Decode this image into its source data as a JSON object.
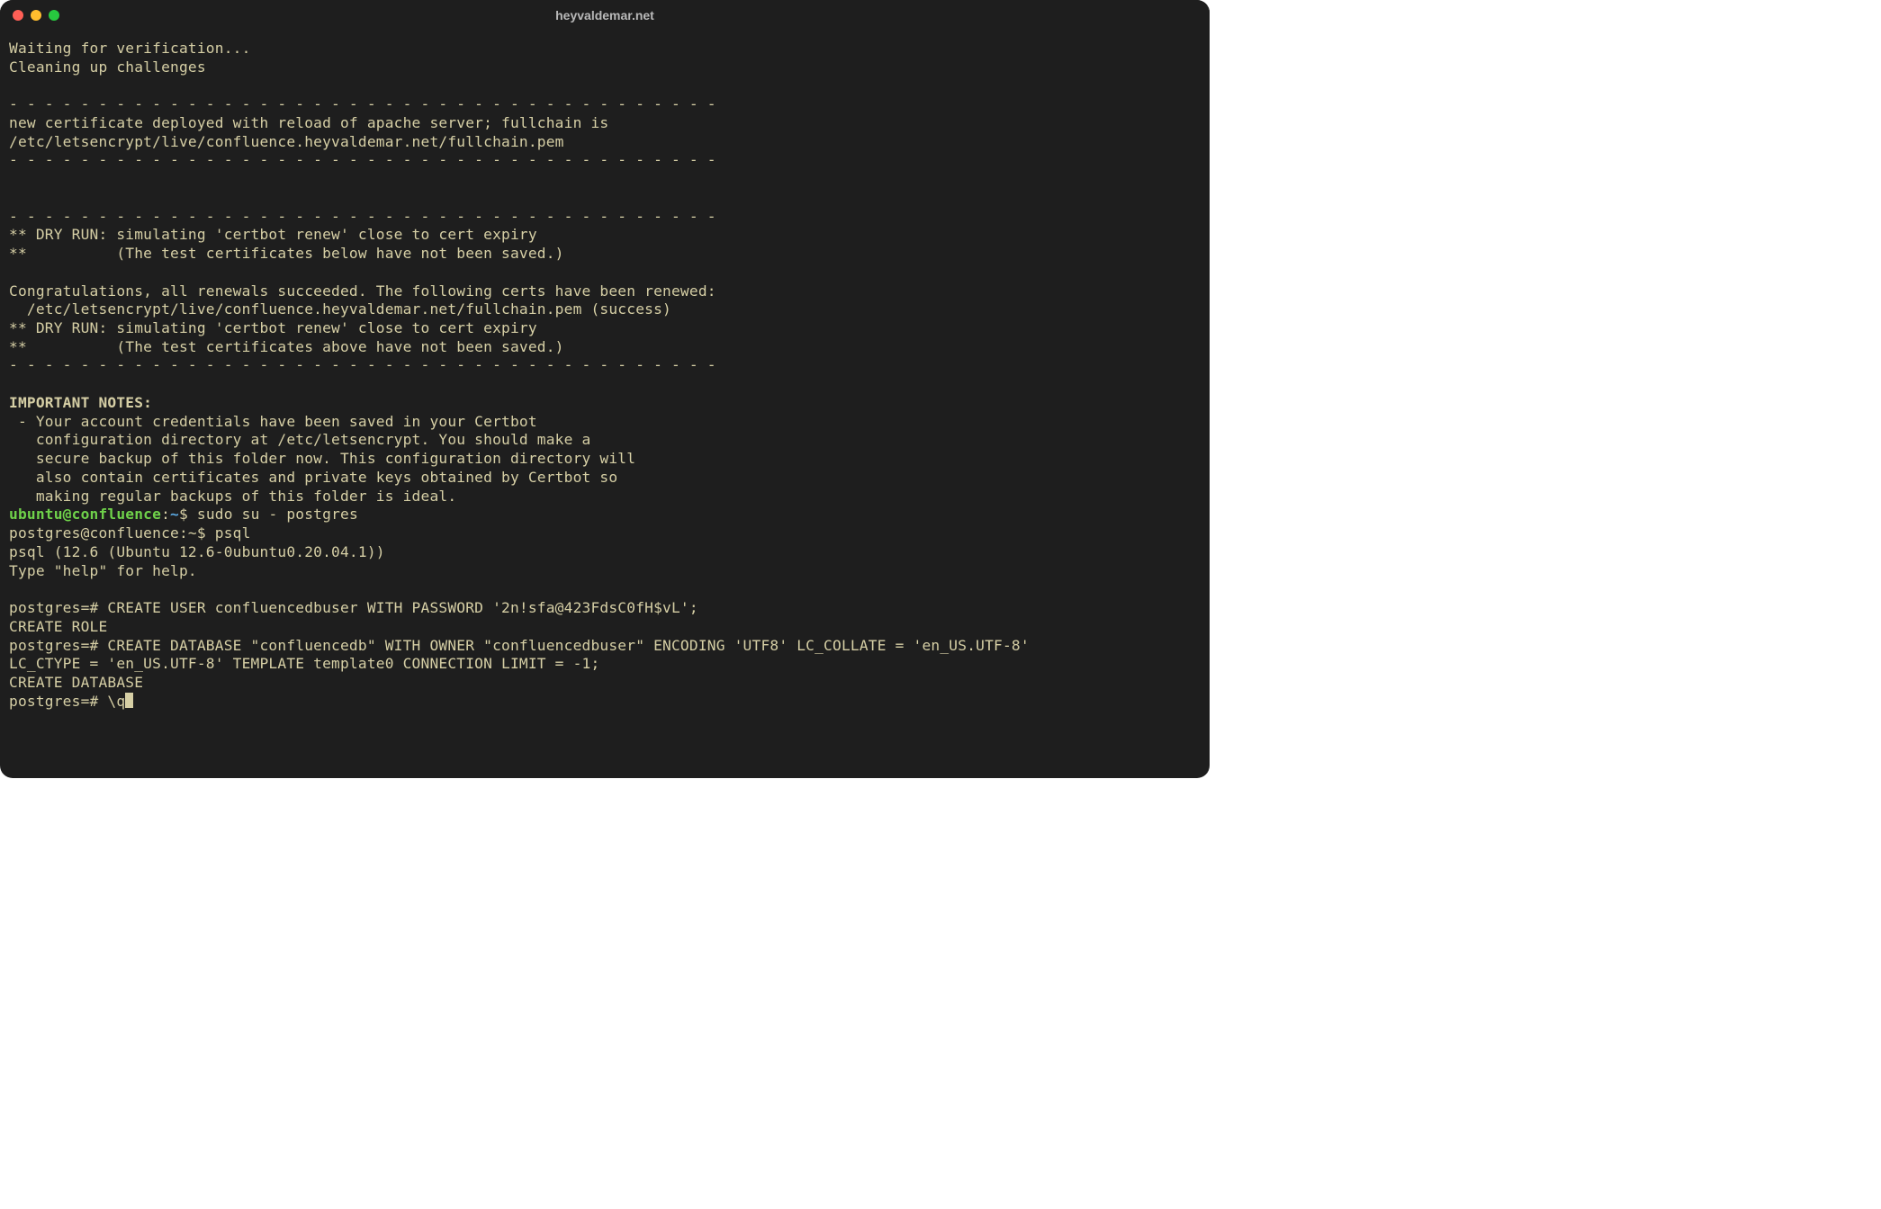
{
  "window": {
    "title": "heyvaldemar.net"
  },
  "colors": {
    "bg": "#1e1e1e",
    "fg": "#d6cfa5",
    "green": "#6fd24a",
    "blue": "#5aa7e0"
  },
  "traffic": {
    "red": "#ff5f56",
    "yellow": "#ffbd2e",
    "green": "#27c93f"
  },
  "text": {
    "waiting": "Waiting for verification...",
    "cleaning": "Cleaning up challenges",
    "blank1": "",
    "dashes1": "- - - - - - - - - - - - - - - - - - - - - - - - - - - - - - - - - - - - - - - -",
    "deploy": "new certificate deployed with reload of apache server; fullchain is",
    "fullchain1": "/etc/letsencrypt/live/confluence.heyvaldemar.net/fullchain.pem",
    "dashes2": "- - - - - - - - - - - - - - - - - - - - - - - - - - - - - - - - - - - - - - - -",
    "blank2": "",
    "blank3": "",
    "dashes3": "- - - - - - - - - - - - - - - - - - - - - - - - - - - - - - - - - - - - - - - -",
    "dry1": "** DRY RUN: simulating 'certbot renew' close to cert expiry",
    "dry1b": "**          (The test certificates below have not been saved.)",
    "blank4": "",
    "congrats": "Congratulations, all renewals succeeded. The following certs have been renewed:",
    "fullchain2": "  /etc/letsencrypt/live/confluence.heyvaldemar.net/fullchain.pem (success)",
    "dry2": "** DRY RUN: simulating 'certbot renew' close to cert expiry",
    "dry2b": "**          (The test certificates above have not been saved.)",
    "dashes4": "- - - - - - - - - - - - - - - - - - - - - - - - - - - - - - - - - - - - - - - -",
    "blank5": "",
    "important": "IMPORTANT NOTES:",
    "note1": " - Your account credentials have been saved in your Certbot",
    "note2": "   configuration directory at /etc/letsencrypt. You should make a",
    "note3": "   secure backup of this folder now. This configuration directory will",
    "note4": "   also contain certificates and private keys obtained by Certbot so",
    "note5": "   making regular backups of this folder is ideal.",
    "prompt1_user": "ubuntu@confluence",
    "prompt1_sep": ":",
    "prompt1_path": "~",
    "prompt1_sym": "$ ",
    "prompt1_cmd": "sudo su - postgres",
    "prompt2": "postgres@confluence:~$ psql",
    "psqlver": "psql (12.6 (Ubuntu 12.6-0ubuntu0.20.04.1))",
    "psqlhelp": "Type \"help\" for help.",
    "blank6": "",
    "sql1": "postgres=# CREATE USER confluencedbuser WITH PASSWORD '2n!sfa@423FdsC0fH$vL';",
    "sql1r": "CREATE ROLE",
    "sql2": "postgres=# CREATE DATABASE \"confluencedb\" WITH OWNER \"confluencedbuser\" ENCODING 'UTF8' LC_COLLATE = 'en_US.UTF-8'",
    "sql2b": "LC_CTYPE = 'en_US.UTF-8' TEMPLATE template0 CONNECTION LIMIT = -1;",
    "sql2r": "CREATE DATABASE",
    "sql3": "postgres=# \\q"
  }
}
